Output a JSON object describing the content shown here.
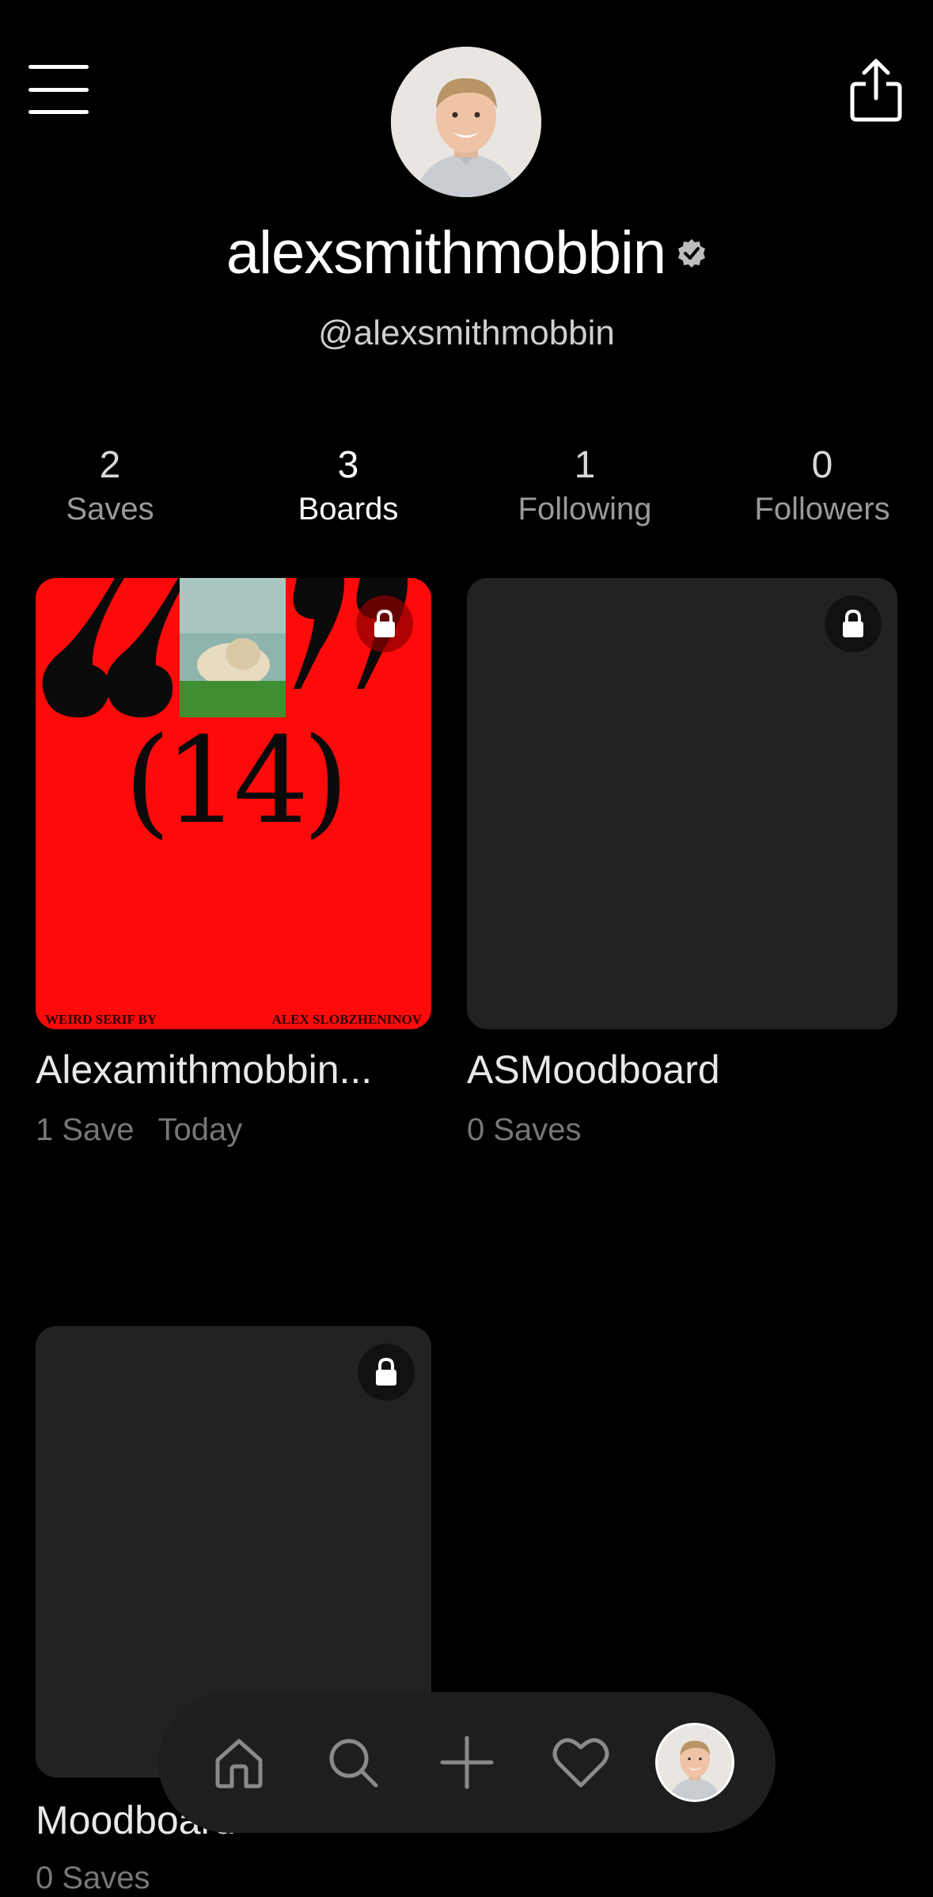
{
  "header": {
    "menu_icon": "hamburger-menu-icon",
    "share_icon": "share-icon"
  },
  "profile": {
    "username": "alexsmithmobbin",
    "handle": "@alexsmithmobbin",
    "verified_icon": "verified-badge-icon"
  },
  "stats": [
    {
      "value": "2",
      "label": "Saves"
    },
    {
      "value": "3",
      "label": "Boards"
    },
    {
      "value": "1",
      "label": "Following"
    },
    {
      "value": "0",
      "label": "Followers"
    }
  ],
  "boards": [
    {
      "title": "Alexamithmobbin...",
      "saves": "1 Save",
      "date": "Today",
      "cover": {
        "big_text": "(14)",
        "caption_left": "WEIRD SERIF BY",
        "caption_right": "ALEX SLOBZHENINOV",
        "background": "#ff0a0a"
      }
    },
    {
      "title": "ASMoodboard",
      "saves": "0 Saves"
    },
    {
      "title": "Moodboard",
      "saves": "0 Saves"
    }
  ],
  "nav": {
    "items": [
      "home-icon",
      "search-icon",
      "add-icon",
      "heart-icon",
      "profile-avatar"
    ]
  },
  "colors": {
    "background": "#000000",
    "card": "#222222",
    "nav": "#1e1e1e",
    "muted_text": "#777777"
  }
}
